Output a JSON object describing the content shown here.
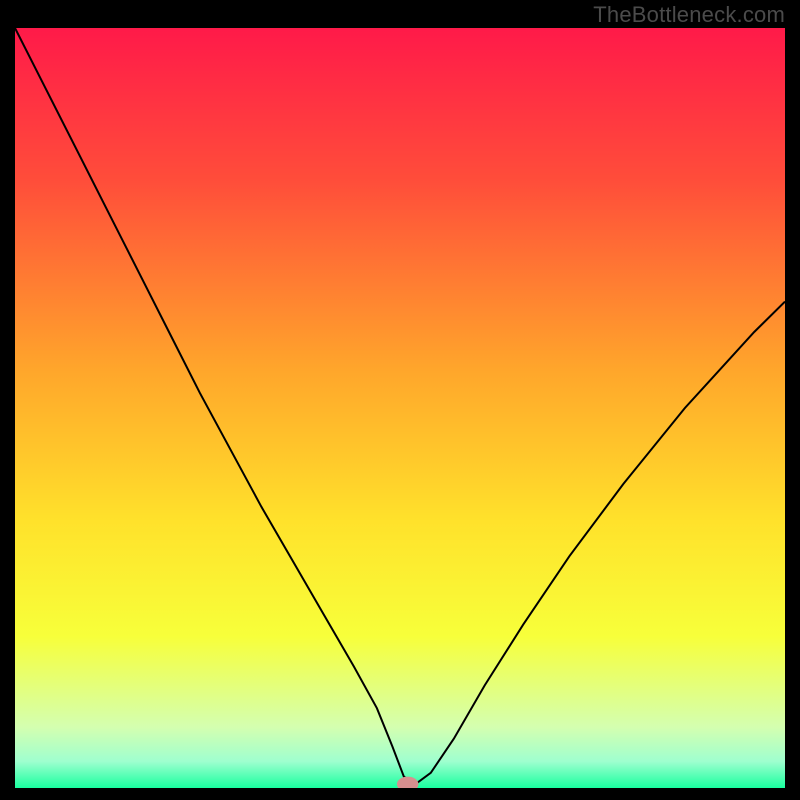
{
  "watermark": "TheBottleneck.com",
  "chart_data": {
    "type": "line",
    "title": "",
    "xlabel": "",
    "ylabel": "",
    "xlim": [
      0,
      100
    ],
    "ylim": [
      0,
      100
    ],
    "gradient_stops": [
      {
        "offset": 0.0,
        "color": "#ff1a49"
      },
      {
        "offset": 0.2,
        "color": "#ff4d3a"
      },
      {
        "offset": 0.45,
        "color": "#ffa62b"
      },
      {
        "offset": 0.65,
        "color": "#ffe22b"
      },
      {
        "offset": 0.8,
        "color": "#f7ff3a"
      },
      {
        "offset": 0.92,
        "color": "#d4ffb0"
      },
      {
        "offset": 0.965,
        "color": "#9fffcf"
      },
      {
        "offset": 1.0,
        "color": "#19ff9f"
      }
    ],
    "series": [
      {
        "name": "bottleneck-curve",
        "x": [
          0.0,
          4.0,
          8.0,
          12.0,
          16.0,
          20.0,
          24.0,
          28.0,
          32.0,
          36.0,
          40.0,
          44.0,
          47.0,
          49.0,
          50.5,
          52.0,
          54.0,
          57.0,
          61.0,
          66.0,
          72.0,
          79.0,
          87.0,
          96.0,
          100.0
        ],
        "y": [
          100.0,
          92.0,
          84.0,
          76.0,
          68.0,
          60.0,
          52.0,
          44.5,
          37.0,
          30.0,
          23.0,
          16.0,
          10.5,
          5.5,
          1.5,
          0.5,
          2.0,
          6.5,
          13.5,
          21.5,
          30.5,
          40.0,
          50.0,
          60.0,
          64.0
        ]
      }
    ],
    "marker": {
      "x": 51.0,
      "y": 0.5,
      "rx": 1.4,
      "ry": 1.0,
      "color": "#d78f8f"
    }
  }
}
